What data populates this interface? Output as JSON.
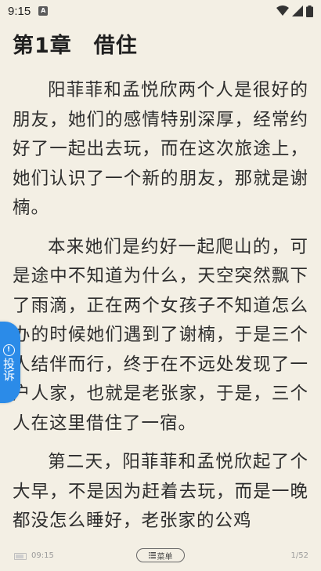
{
  "status_bar": {
    "time": "9:15",
    "app_icon_letter": "A"
  },
  "chapter": {
    "title": "第1章　借住",
    "paragraphs": [
      "阳菲菲和孟悦欣两个人是很好的朋友，她们的感情特别深厚，经常约好了一起出去玩，而在这次旅途上，她们认识了一个新的朋友，那就是谢楠。",
      "本来她们是约好一起爬山的，可是途中不知道为什么，天空突然飘下了雨滴，正在两个女孩子不知道怎么办的时候她们遇到了谢楠，于是三个人结伴而行，终于在不远处发现了一户人家，也就是老张家，于是，三个人在这里借住了一宿。",
      "第二天，阳菲菲和孟悦欣起了个大早，不是因为赶着去玩，而是一晚都没怎么睡好，老张家的公鸡"
    ]
  },
  "side_tab": {
    "label": "投诉"
  },
  "bottom_bar": {
    "time": "09:15",
    "menu_label": "菜单",
    "page": "1/52"
  },
  "colors": {
    "background": "#f3efe4",
    "accent": "#2b8be8"
  }
}
